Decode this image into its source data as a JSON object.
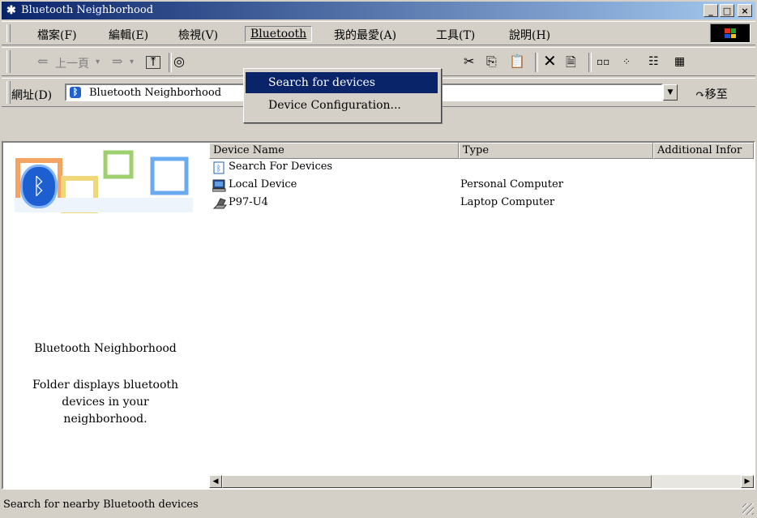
{
  "window": {
    "title": "Bluetooth Neighborhood",
    "title_icon": "bluetooth-icon",
    "buttons": {
      "minimize": "_",
      "maximize": "□",
      "close": "×"
    }
  },
  "menubar": {
    "items": [
      "檔案(F)",
      "編輯(E)",
      "檢視(V)",
      "Bluetooth",
      "我的最愛(A)",
      "工具(T)",
      "說明(H)"
    ],
    "active": "Bluetooth"
  },
  "toolbar": {
    "back_label": "上一頁",
    "icons": [
      "back-arrow-icon",
      "forward-arrow-icon",
      "up-folder-icon",
      "search-icon",
      "cut-icon",
      "copy-icon",
      "paste-icon",
      "delete-icon",
      "properties-icon",
      "large-icons-view-icon",
      "small-icons-view-icon",
      "list-view-icon",
      "details-view-icon"
    ]
  },
  "address": {
    "label": "網址(D)",
    "value": "Bluetooth Neighborhood",
    "go_label": "移至"
  },
  "dropdown": {
    "items": [
      "Search for devices",
      "Device Configuration..."
    ],
    "selected": "Search for devices"
  },
  "left_pane": {
    "title": "Bluetooth Neighborhood",
    "description": "Folder displays bluetooth devices in your neighborhood."
  },
  "list": {
    "columns": [
      "Device Name",
      "Type",
      "Additional Infor"
    ],
    "rows": [
      {
        "name": "Search For Devices",
        "type": "",
        "icon": "bluetooth-search-icon"
      },
      {
        "name": "Local Device",
        "type": "Personal Computer",
        "icon": "computer-icon"
      },
      {
        "name": "P97-U4",
        "type": "Laptop Computer",
        "icon": "laptop-icon"
      }
    ]
  },
  "status": {
    "text": "Search for nearby Bluetooth devices"
  },
  "colors": {
    "titlebar_start": "#0a246a",
    "titlebar_end": "#a6caf0",
    "selection": "#0a246a",
    "face": "#d4d0c8",
    "bluetooth_blue": "#1d5fd0"
  }
}
